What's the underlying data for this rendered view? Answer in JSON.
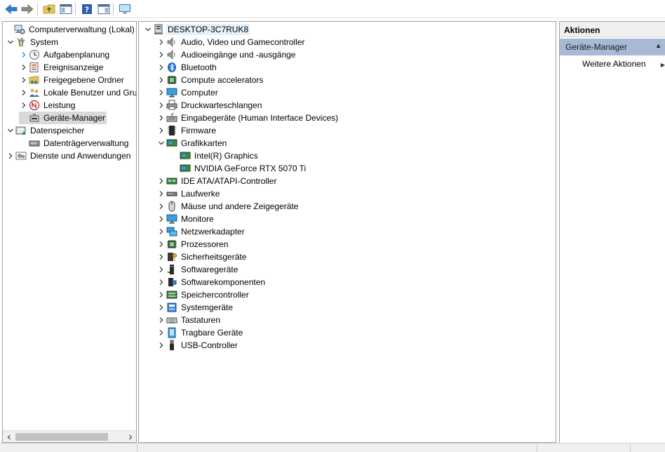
{
  "toolbar": {
    "buttons": [
      "back-icon",
      "forward-icon",
      "up-folder-icon",
      "show-hide-tree-icon",
      "help-icon",
      "show-action-pane-icon",
      "monitor-icon"
    ]
  },
  "left_tree": {
    "items": [
      {
        "label": "Computerverwaltung (Lokal)",
        "icon": "computer-management-icon",
        "chevron": "",
        "level": 0
      },
      {
        "label": "System",
        "icon": "tools-icon",
        "chevron": "expanded",
        "level": 1
      },
      {
        "label": "Aufgabenplanung",
        "icon": "clock-icon",
        "chevron": "collapsed-blue",
        "level": 2
      },
      {
        "label": "Ereignisanzeige",
        "icon": "event-viewer-icon",
        "chevron": "collapsed",
        "level": 2
      },
      {
        "label": "Freigegebene Ordner",
        "icon": "shared-folder-icon",
        "chevron": "collapsed",
        "level": 2
      },
      {
        "label": "Lokale Benutzer und Gru",
        "icon": "users-icon",
        "chevron": "collapsed",
        "level": 2
      },
      {
        "label": "Leistung",
        "icon": "performance-icon",
        "chevron": "collapsed",
        "level": 2
      },
      {
        "label": "Geräte-Manager",
        "icon": "device-manager-icon",
        "chevron": "",
        "level": 2,
        "selected": true
      },
      {
        "label": "Datenspeicher",
        "icon": "storage-icon",
        "chevron": "expanded",
        "level": 1
      },
      {
        "label": "Datenträgerverwaltung",
        "icon": "disk-management-icon",
        "chevron": "",
        "level": 2
      },
      {
        "label": "Dienste und Anwendungen",
        "icon": "services-icon",
        "chevron": "collapsed",
        "level": 1
      }
    ]
  },
  "device_tree": {
    "host": "DESKTOP-3C7RUK8",
    "categories": [
      {
        "label": "Audio, Video und Gamecontroller",
        "icon": "speaker-icon",
        "expanded": false
      },
      {
        "label": "Audioeingänge und -ausgänge",
        "icon": "speaker-icon",
        "expanded": false
      },
      {
        "label": "Bluetooth",
        "icon": "bluetooth-icon",
        "expanded": false
      },
      {
        "label": "Compute accelerators",
        "icon": "chip-icon",
        "expanded": false
      },
      {
        "label": "Computer",
        "icon": "monitor-icon",
        "expanded": false
      },
      {
        "label": "Druckwarteschlangen",
        "icon": "printer-icon",
        "expanded": false
      },
      {
        "label": "Eingabegeräte (Human Interface Devices)",
        "icon": "hid-icon",
        "expanded": false
      },
      {
        "label": "Firmware",
        "icon": "firmware-icon",
        "expanded": false
      },
      {
        "label": "Grafikkarten",
        "icon": "display-adapter-icon",
        "expanded": true,
        "children": [
          {
            "label": "Intel(R) Graphics",
            "icon": "display-adapter-icon"
          },
          {
            "label": "NVIDIA GeForce RTX 5070 Ti",
            "icon": "display-adapter-icon"
          }
        ]
      },
      {
        "label": "IDE ATA/ATAPI-Controller",
        "icon": "ide-controller-icon",
        "expanded": false
      },
      {
        "label": "Laufwerke",
        "icon": "drive-icon",
        "expanded": false
      },
      {
        "label": "Mäuse und andere Zeigegeräte",
        "icon": "mouse-icon",
        "expanded": false
      },
      {
        "label": "Monitore",
        "icon": "monitor-icon",
        "expanded": false
      },
      {
        "label": "Netzwerkadapter",
        "icon": "network-icon",
        "expanded": false
      },
      {
        "label": "Prozessoren",
        "icon": "chip-icon",
        "expanded": false
      },
      {
        "label": "Sicherheitsgeräte",
        "icon": "security-icon",
        "expanded": false
      },
      {
        "label": "Softwaregeräte",
        "icon": "software-device-icon",
        "expanded": false
      },
      {
        "label": "Softwarekomponenten",
        "icon": "software-component-icon",
        "expanded": false
      },
      {
        "label": "Speichercontroller",
        "icon": "storage-controller-icon",
        "expanded": false
      },
      {
        "label": "Systemgeräte",
        "icon": "system-device-icon",
        "expanded": false
      },
      {
        "label": "Tastaturen",
        "icon": "keyboard-icon",
        "expanded": false
      },
      {
        "label": "Tragbare Geräte",
        "icon": "portable-device-icon",
        "expanded": false
      },
      {
        "label": "USB-Controller",
        "icon": "usb-icon",
        "expanded": false
      }
    ]
  },
  "actions": {
    "header": "Aktionen",
    "section": "Geräte-Manager",
    "more": "Weitere Aktionen",
    "more_arrow": "▶"
  },
  "colors": {
    "selection": "#d9d9d9",
    "host_highlight": "#e5f1fb",
    "action_section": "#a7b9d4",
    "chevron": "#404040",
    "chevron_hover": "#1e90ff"
  }
}
